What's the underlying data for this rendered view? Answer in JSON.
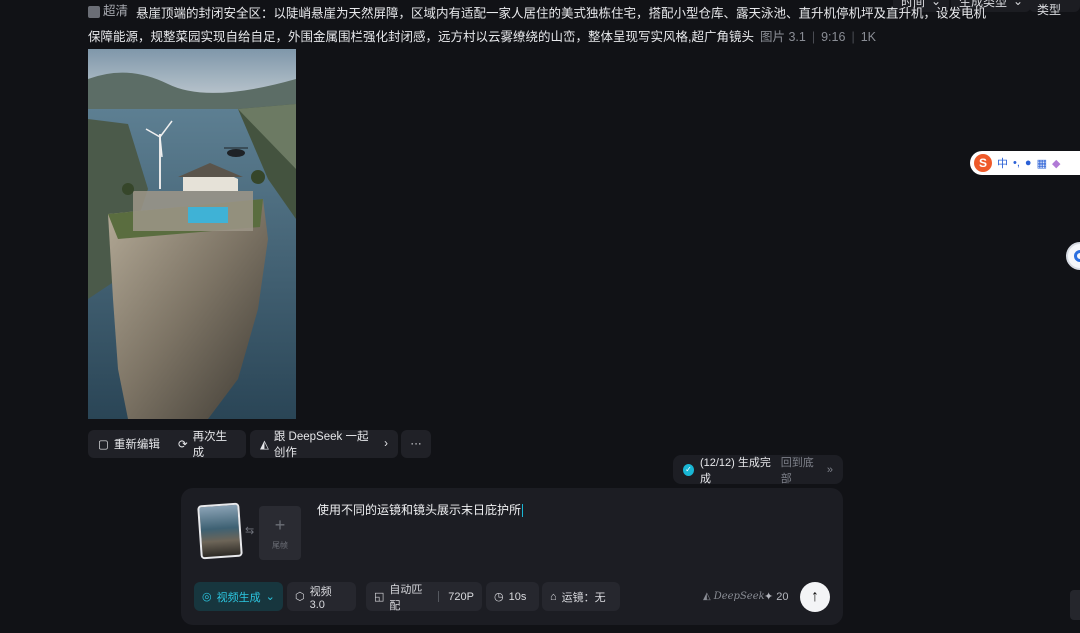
{
  "top_filters": [
    {
      "label": "时间",
      "icon": "chevron-down-icon"
    },
    {
      "label": "生成类型",
      "icon": "chevron-down-icon"
    },
    {
      "label": "操作类型",
      "icon": ""
    }
  ],
  "caption": {
    "badge": "超清",
    "text": "悬崖顶端的封闭安全区：以陡峭悬崖为天然屏障，区域内有适配一家人居住的美式独栋住宅，搭配小型仓库、露天泳池、直升机停机坪及直升机，设发电机保障能源，规整菜园实现自给自足，外围金属围栏强化封闭感，远方村以云雾缭绕的山峦，整体呈现写实风格,超广角镜头",
    "model": "图片 3.1",
    "ratio": "9:16",
    "resolution": "1K"
  },
  "actions": {
    "reedit": "重新编辑",
    "regenerate": "再次生成",
    "deepseek": "跟 DeepSeek 一起创作",
    "more": "···"
  },
  "status": {
    "progress": "(12/12) 生成完成",
    "back": "回到底部"
  },
  "composer": {
    "add_tail_label": "尾帧",
    "prompt": "使用不同的运镜和镜头展示末日庇护所",
    "chips": {
      "mode": "视频生成",
      "model": "视频 3.0",
      "ratio": "自动匹配",
      "resolution": "720P",
      "duration": "10s",
      "camera": "运镜：无"
    },
    "deepseek_logo": "DeepSeek",
    "credits": "20"
  },
  "ime": {
    "logo": "S",
    "lang": "中",
    "punct": "•,"
  },
  "colors": {
    "background": "#111216",
    "accent": "#19b6d4",
    "chip_bg": "#26272e"
  }
}
